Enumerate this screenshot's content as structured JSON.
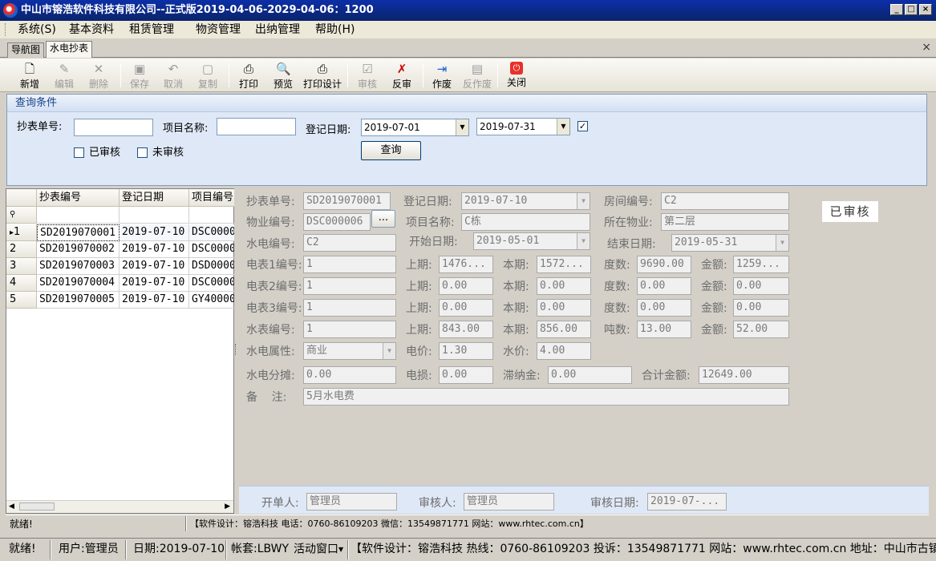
{
  "window": {
    "title": "中山市镕浩软件科技有限公司--正式版2019-04-06-2029-04-06：1200",
    "min": "_",
    "max": "□",
    "close": "×"
  },
  "menu": [
    "系统(S)",
    "基本资料",
    "租赁管理",
    "物资管理",
    "出纳管理",
    "帮助(H)"
  ],
  "tabs": {
    "nav": "导航图",
    "active": "水电抄表",
    "close": "×"
  },
  "toolbar": {
    "new": {
      "label": "新增",
      "icon": "new-document-icon"
    },
    "edit": {
      "label": "编辑",
      "icon": "edit-icon"
    },
    "delete": {
      "label": "删除",
      "icon": "delete-icon"
    },
    "save": {
      "label": "保存",
      "icon": "save-icon"
    },
    "cancel": {
      "label": "取消",
      "icon": "undo-icon"
    },
    "copy": {
      "label": "复制",
      "icon": "copy-icon"
    },
    "print": {
      "label": "打印",
      "icon": "printer-icon"
    },
    "preview": {
      "label": "预览",
      "icon": "preview-icon"
    },
    "print_design": {
      "label": "打印设计",
      "icon": "print-design-icon"
    },
    "audit": {
      "label": "审核",
      "icon": "audit-icon"
    },
    "unaudit": {
      "label": "反审",
      "icon": "unaudit-icon"
    },
    "void": {
      "label": "作废",
      "icon": "void-icon"
    },
    "unvoid": {
      "label": "反作废",
      "icon": "unvoid-icon"
    },
    "close": {
      "label": "关闭",
      "icon": "power-icon"
    }
  },
  "query": {
    "title": "查询条件",
    "bill_no_label": "抄表单号:",
    "bill_no_value": "",
    "project_label": "项目名称:",
    "project_value": "",
    "date_label": "登记日期:",
    "date_from": "2019-07-01",
    "date_to": "2019-07-31",
    "date_checked": "✓",
    "audited_label": "已审核",
    "unaudited_label": "未审核",
    "search_button": "查询"
  },
  "grid": {
    "columns": [
      "抄表编号",
      "登记日期",
      "项目编号"
    ],
    "filter_icon": "filter-icon",
    "rows": [
      {
        "num": "1",
        "id": "SD2019070001",
        "date": "2019-07-10",
        "proj": "DSC0000"
      },
      {
        "num": "2",
        "id": "SD2019070002",
        "date": "2019-07-10",
        "proj": "DSC0000"
      },
      {
        "num": "3",
        "id": "SD2019070003",
        "date": "2019-07-10",
        "proj": "DSD0000"
      },
      {
        "num": "4",
        "id": "SD2019070004",
        "date": "2019-07-10",
        "proj": "DSC0000"
      },
      {
        "num": "5",
        "id": "SD2019070005",
        "date": "2019-07-10",
        "proj": "GY40000"
      }
    ]
  },
  "detail": {
    "stamp": "已审核",
    "bill_no": {
      "label": "抄表单号:",
      "value": "SD2019070001"
    },
    "reg_date": {
      "label": "登记日期:",
      "value": "2019-07-10"
    },
    "room_no": {
      "label": "房间编号:",
      "value": "C2"
    },
    "prop_no": {
      "label": "物业编号:",
      "value": "DSC000006",
      "btn": "..."
    },
    "proj_name": {
      "label": "项目名称:",
      "value": "C栋"
    },
    "location": {
      "label": "所在物业:",
      "value": "第二层"
    },
    "utility_no": {
      "label": "水电编号:",
      "value": "C2"
    },
    "start_date": {
      "label": "开始日期:",
      "value": "2019-05-01"
    },
    "end_date": {
      "label": "结束日期:",
      "value": "2019-05-31"
    },
    "meter1": {
      "label": "电表1编号:",
      "value": "1",
      "prev_label": "上期:",
      "prev": "1476...",
      "cur_label": "本期:",
      "cur": "1572...",
      "deg_label": "度数:",
      "deg": "9690.00",
      "amt_label": "金额:",
      "amt": "1259..."
    },
    "meter2": {
      "label": "电表2编号:",
      "value": "1",
      "prev_label": "上期:",
      "prev": "0.00",
      "cur_label": "本期:",
      "cur": "0.00",
      "deg_label": "度数:",
      "deg": "0.00",
      "amt_label": "金额:",
      "amt": "0.00"
    },
    "meter3": {
      "label": "电表3编号:",
      "value": "1",
      "prev_label": "上期:",
      "prev": "0.00",
      "cur_label": "本期:",
      "cur": "0.00",
      "deg_label": "度数:",
      "deg": "0.00",
      "amt_label": "金额:",
      "amt": "0.00"
    },
    "water": {
      "label": "水表编号:",
      "value": "1",
      "prev_label": "上期:",
      "prev": "843.00",
      "cur_label": "本期:",
      "cur": "856.00",
      "deg_label": "吨数:",
      "deg": "13.00",
      "amt_label": "金额:",
      "amt": "52.00"
    },
    "attr": {
      "label": "水电属性:",
      "value": "商业"
    },
    "elec_price": {
      "label": "电价:",
      "value": "1.30"
    },
    "water_price": {
      "label": "水价:",
      "value": "4.00"
    },
    "share": {
      "label": "水电分摊:",
      "value": "0.00"
    },
    "loss": {
      "label": "电损:",
      "value": "0.00"
    },
    "late_fee": {
      "label": "滞纳金:",
      "value": "0.00"
    },
    "total": {
      "label": "合计金额:",
      "value": "12649.00"
    },
    "remark": {
      "label": "备    注:",
      "value": "5月水电费"
    }
  },
  "footer": {
    "creator_label": "开单人:",
    "creator": "管理员",
    "auditor_label": "审核人:",
    "auditor": "管理员",
    "audit_date_label": "审核日期:",
    "audit_date": "2019-07-..."
  },
  "status1": {
    "left": "就绪!",
    "center": "【软件设计：镕浩科技 电话：0760-86109203 微信：13549871771 网站：www.rhtec.com.cn】"
  },
  "status2": {
    "ready": "就绪!",
    "user": "用户:管理员",
    "date": "日期:2019-07-10",
    "account": "帐套:LBWY",
    "window": "活动窗口",
    "info": "【软件设计：镕浩科技 热线：0760-86109203 投诉：13549871771 网站：www.rhtec.com.cn 地址：中山市古镇六坊"
  }
}
